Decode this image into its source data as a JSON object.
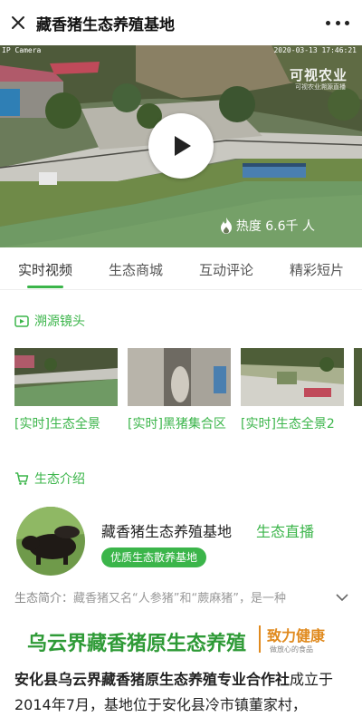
{
  "header": {
    "title": "藏香猪生态养殖基地"
  },
  "video": {
    "camera_label": "IP Camera",
    "timestamp": "2020-03-13 17:46:21",
    "watermark_main": "可视农业",
    "watermark_sub": "可视农业溯源直播",
    "heat_label": "热度 6.6千 人"
  },
  "tabs": [
    {
      "label": "实时视频",
      "active": true
    },
    {
      "label": "生态商城"
    },
    {
      "label": "互动评论"
    },
    {
      "label": "精彩短片"
    }
  ],
  "trace": {
    "title": "溯源镜头",
    "items": [
      {
        "caption": "[实时]生态全景"
      },
      {
        "caption": "[实时]黑猪集合区"
      },
      {
        "caption": "[实时]生态全景2"
      }
    ]
  },
  "eco": {
    "title": "生态介绍",
    "farm_name": "藏香猪生态养殖基地",
    "live_link": "生态直播",
    "badge": "优质生态散养基地",
    "intro_label": "生态简介：",
    "intro_text": "藏香猪又名“人参猪”和“蕨麻猪”，是一种"
  },
  "banner": {
    "main": "乌云界藏香猪原生态养殖",
    "slogan": "致力健康",
    "slogan_sub": "做放心的食品"
  },
  "article": {
    "bold": "安化县乌云界藏香猪原生态养殖专业合作社",
    "rest": "成立于2014年7月，基地位于安化县冷市镇董家村，"
  },
  "colors": {
    "accent": "#3bb54a",
    "orange": "#e08a1e"
  }
}
